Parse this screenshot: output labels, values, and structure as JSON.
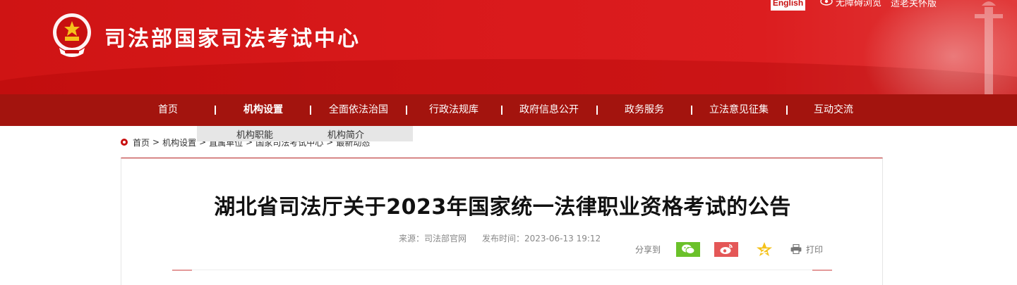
{
  "header": {
    "site_title": "司法部国家司法考试中心",
    "english_label": "English",
    "accessibility_label": "无障碍浏览",
    "elder_label": "适老关怀版"
  },
  "nav": {
    "items": [
      {
        "label": "首页"
      },
      {
        "label": "机构设置",
        "active": true
      },
      {
        "label": "全面依法治国"
      },
      {
        "label": "行政法规库"
      },
      {
        "label": "政府信息公开"
      },
      {
        "label": "政务服务"
      },
      {
        "label": "立法意见征集"
      },
      {
        "label": "互动交流"
      }
    ],
    "submenu": [
      "机构职能",
      "机构简介"
    ]
  },
  "breadcrumb": {
    "items": [
      "首页",
      "机构设置",
      "直属单位",
      "国家司法考试中心",
      "最新动态"
    ],
    "separator": ">"
  },
  "article": {
    "title": "湖北省司法厅关于2023年国家统一法律职业资格考试的公告",
    "source": "来源：司法部官网",
    "published": "发布时间：2023-06-13 19:12",
    "share_label": "分享到",
    "print_label": "打印"
  },
  "icons": {
    "emblem": "national-emblem-icon",
    "eye": "eye-icon",
    "wechat": "wechat-icon",
    "weibo": "weibo-icon",
    "qzone": "qzone-star-icon",
    "print": "printer-icon"
  },
  "colors": {
    "brand_red": "#d9191b",
    "nav_red": "#a3140e",
    "wechat_green": "#6bc12a",
    "weibo_red": "#e45757",
    "qzone_yellow": "#f5c21b"
  }
}
